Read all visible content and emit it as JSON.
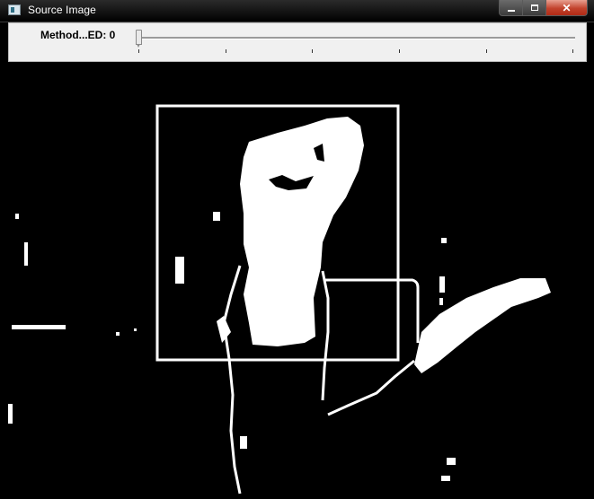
{
  "window": {
    "title": "Source Image"
  },
  "trackbar": {
    "label": "Method...ED: 0",
    "value": 0
  },
  "window_controls": {
    "minimize": "minimize",
    "maximize": "maximize",
    "close": "close"
  },
  "icons": [
    "app-window-icon",
    "minimize-icon",
    "maximize-icon",
    "close-icon"
  ],
  "colors": {
    "background": "#000000",
    "foreground": "#ffffff",
    "panel": "#f0f0f0",
    "close_button": "#c2432d"
  }
}
